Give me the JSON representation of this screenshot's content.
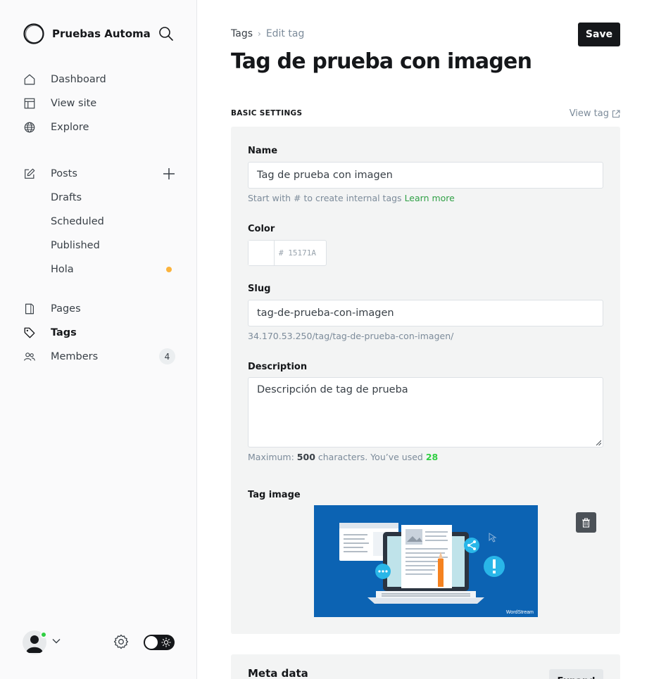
{
  "sidebar": {
    "site_title": "Pruebas Automa...",
    "nav_main": [
      {
        "label": "Dashboard",
        "icon": "home-icon"
      },
      {
        "label": "View site",
        "icon": "layout-icon"
      },
      {
        "label": "Explore",
        "icon": "globe-icon"
      }
    ],
    "posts": {
      "label": "Posts",
      "icon": "edit-icon"
    },
    "post_subitems": [
      {
        "label": "Drafts"
      },
      {
        "label": "Scheduled"
      },
      {
        "label": "Published"
      },
      {
        "label": "Hola"
      }
    ],
    "nav_secondary": [
      {
        "label": "Pages",
        "icon": "page-icon"
      },
      {
        "label": "Tags",
        "icon": "tag-icon"
      },
      {
        "label": "Members",
        "icon": "members-icon",
        "count": "4"
      }
    ],
    "colors": {
      "accent_dot": "#fbb33c",
      "online": "#30cf43"
    }
  },
  "header": {
    "breadcrumb_root": "Tags",
    "breadcrumb_current": "Edit tag",
    "save_label": "Save",
    "title": "Tag de prueba con imagen"
  },
  "basic_settings": {
    "section_label": "BASIC SETTINGS",
    "view_tag_label": "View tag",
    "name_label": "Name",
    "name_value": "Tag de prueba con imagen",
    "name_hint": "Start with # to create internal tags",
    "name_hint_link": "Learn more",
    "color_label": "Color",
    "color_value": "# 15171A",
    "slug_label": "Slug",
    "slug_value": "tag-de-prueba-con-imagen",
    "slug_url": "34.170.53.250/tag/tag-de-prueba-con-imagen/",
    "description_label": "Description",
    "description_value": "Descripción de tag de prueba",
    "desc_hint_prefix": "Maximum:",
    "desc_hint_max": "500",
    "desc_hint_mid": "characters. You’ve used",
    "desc_hint_used": "28",
    "tag_image_label": "Tag image",
    "tag_image_watermark": "WordStream"
  },
  "meta_data": {
    "title": "Meta data",
    "expand_label": "Expand"
  }
}
